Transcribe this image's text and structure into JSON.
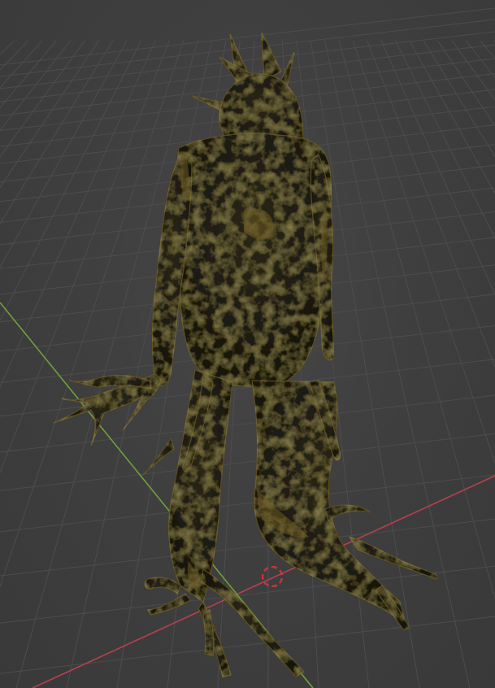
{
  "viewport": {
    "background": "#3d3d3d",
    "grid_color": "#4d4d4d",
    "x_axis_color": "#c04a55",
    "y_axis_color": "#7fb040"
  },
  "object": {
    "icon": "tree-creature-mesh",
    "base_color": "#1c1a12",
    "highlight_color": "#6b5a22"
  },
  "cursor": {
    "icon": "3d-cursor-icon"
  }
}
